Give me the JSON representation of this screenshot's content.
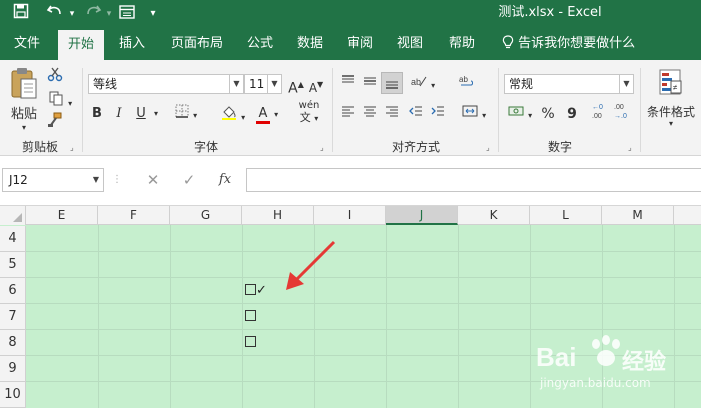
{
  "window": {
    "title": "测试.xlsx  -  Excel",
    "brand_color": "#217346"
  },
  "quick_access": {
    "save_icon": "save-icon",
    "undo_icon": "undo-icon",
    "redo_icon": "redo-icon",
    "form_icon": "form-icon",
    "customize_icon": "customize-qat-icon"
  },
  "tabs": [
    {
      "label": "文件"
    },
    {
      "label": "开始",
      "active": true
    },
    {
      "label": "插入"
    },
    {
      "label": "页面布局"
    },
    {
      "label": "公式"
    },
    {
      "label": "数据"
    },
    {
      "label": "审阅"
    },
    {
      "label": "视图"
    },
    {
      "label": "帮助"
    }
  ],
  "tell_me": "告诉我你想要做什么",
  "ribbon": {
    "clipboard": {
      "label": "剪贴板",
      "paste_label": "粘贴"
    },
    "font": {
      "label": "字体",
      "font_name": "等线",
      "font_size": "11",
      "bold": "B",
      "italic": "I",
      "underline": "U",
      "grow_font": "A",
      "shrink_font": "A",
      "font_color_letter": "A",
      "phonetic": "wén",
      "font_color": "#e00000"
    },
    "alignment": {
      "label": "对齐方式"
    },
    "number": {
      "label": "数字",
      "format": "常规",
      "percent": "%",
      "comma": "9"
    },
    "styles": {
      "cond_format_label": "条件格式"
    }
  },
  "formula_bar": {
    "name_box": "J12",
    "fx": "fx",
    "formula": ""
  },
  "grid": {
    "columns": [
      "E",
      "F",
      "G",
      "H",
      "I",
      "J",
      "K",
      "L",
      "M"
    ],
    "selected_column": "J",
    "rows": [
      "4",
      "5",
      "6",
      "7",
      "8",
      "9",
      "10"
    ],
    "fill_color": "#c6efce",
    "cells": {
      "h6_mark": "✓"
    }
  },
  "watermark": {
    "brand": "Bai",
    "brand_cn": "经验",
    "url": "jingyan.baidu.com"
  }
}
